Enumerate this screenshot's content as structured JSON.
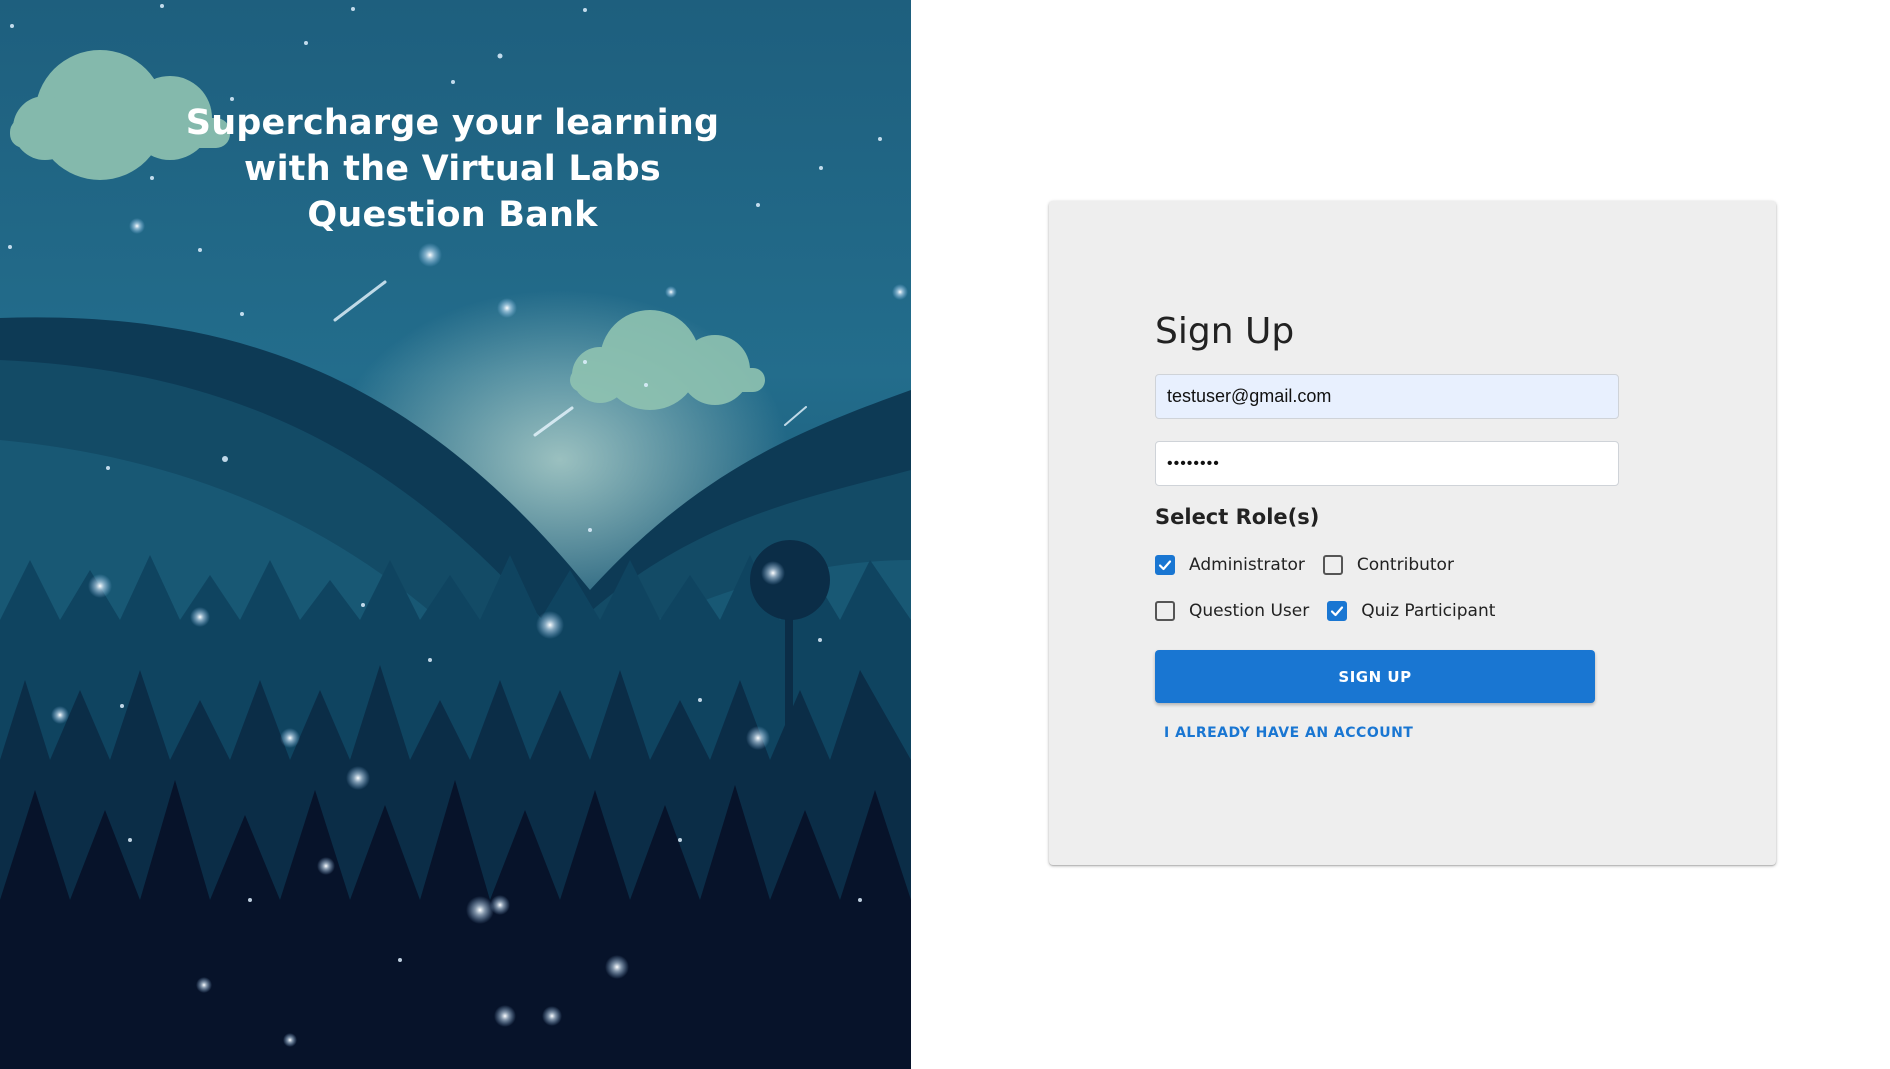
{
  "hero": {
    "title_line1": "Supercharge your learning",
    "title_line2": "with the Virtual Labs",
    "title_line3": "Question Bank"
  },
  "signup": {
    "title": "Sign Up",
    "email_value": "testuser@gmail.com",
    "password_value": "••••••••",
    "roles_heading": "Select Role(s)",
    "roles": [
      {
        "label": "Administrator",
        "checked": true
      },
      {
        "label": "Contributor",
        "checked": false
      },
      {
        "label": "Question User",
        "checked": false
      },
      {
        "label": "Quiz Participant",
        "checked": true
      }
    ],
    "submit_label": "SIGN UP",
    "login_link": "I ALREADY HAVE AN ACCOUNT"
  },
  "colors": {
    "accent": "#1976d2",
    "card_bg": "#eeeeee",
    "email_autofill_bg": "#e8f0fe",
    "hero_sky": "#236d8c",
    "hero_forest": "#08152c"
  },
  "icons": {
    "checkbox_checked": "check-icon"
  }
}
